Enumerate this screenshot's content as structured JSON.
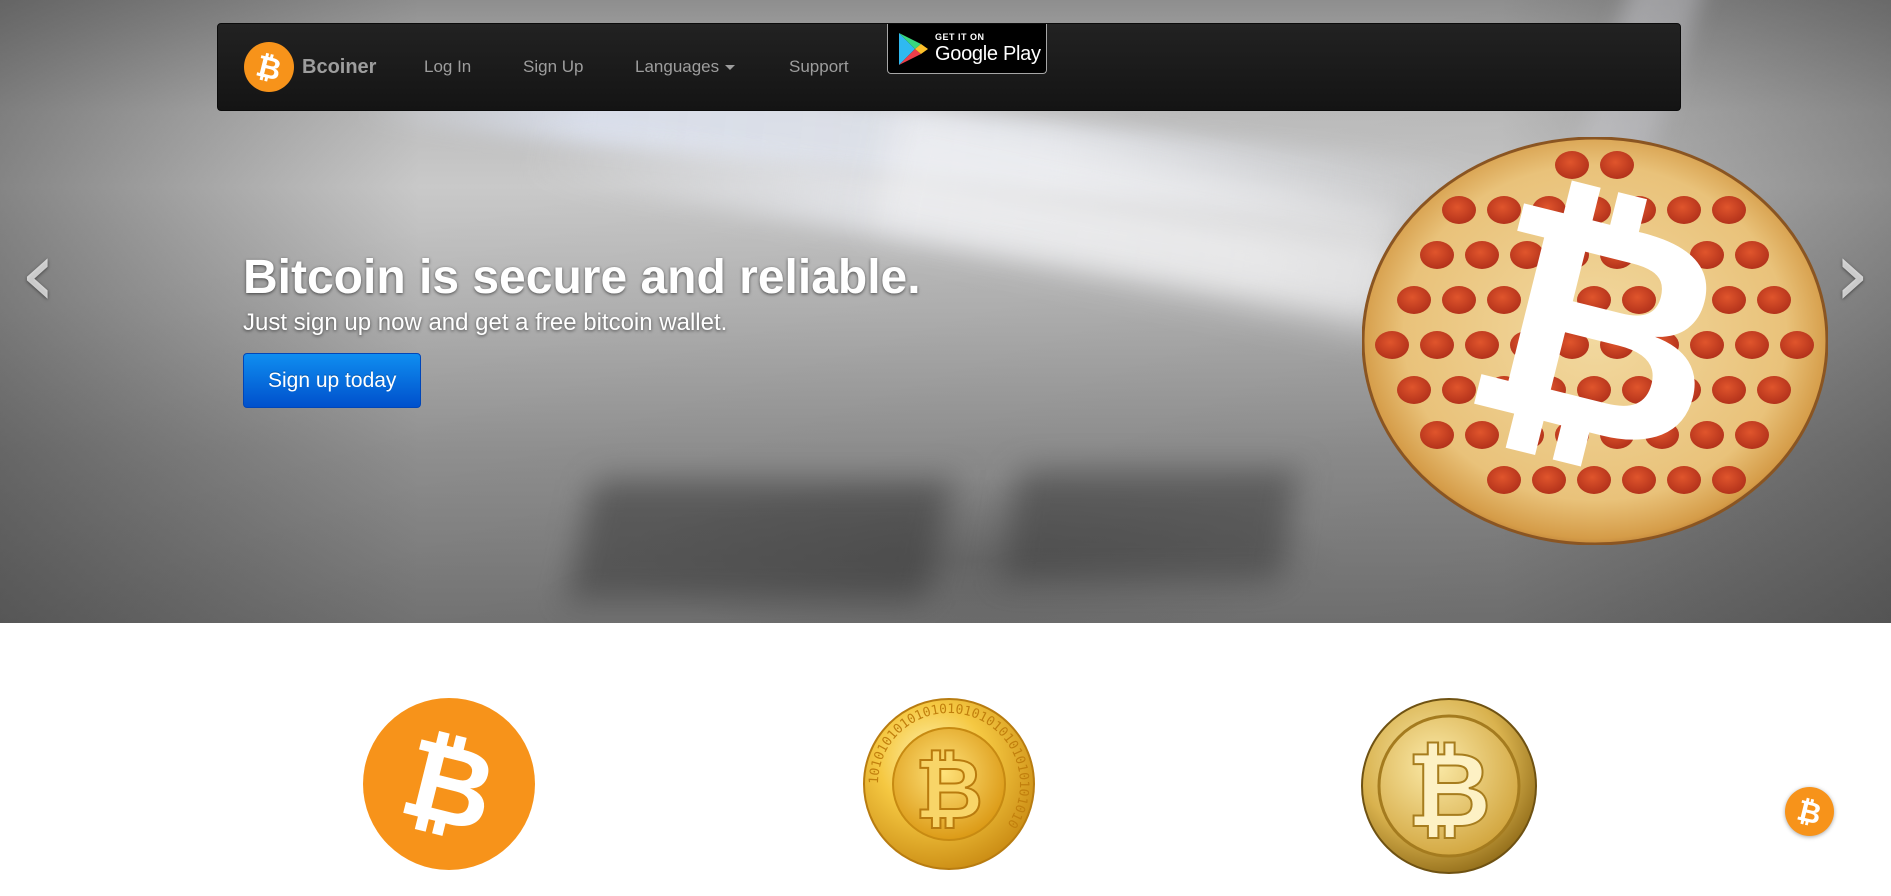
{
  "navbar": {
    "brand_name": "Bcoiner",
    "brand_icon": "bitcoin-logo-icon",
    "links": {
      "login": "Log In",
      "signup": "Sign Up",
      "languages": "Languages",
      "support": "Support"
    },
    "play_badge": {
      "small_text": "GET IT ON",
      "big_text": "Google Play",
      "icon": "google-play-icon"
    }
  },
  "carousel": {
    "prev_arrow": "‹",
    "next_arrow": "›",
    "headline": "Bitcoin is secure and reliable.",
    "subtext": "Just sign up now and get a free bitcoin wallet.",
    "cta_label": "Sign up today",
    "image": "bitcoin-pizza-image"
  },
  "features": {
    "icons": [
      "bitcoin-orange-icon",
      "bitcoin-gold-binary-coin-icon",
      "bitcoin-gold-coin-icon"
    ]
  },
  "floating_button": {
    "icon": "bitcoin-chat-icon"
  },
  "colors": {
    "bitcoin_orange": "#f7931a",
    "navbar_bg": "#1b1b1b",
    "nav_text": "#9d9d9d",
    "cta_blue": "#0a6fe0"
  }
}
